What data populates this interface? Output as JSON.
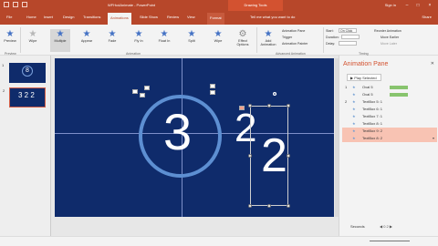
{
  "window": {
    "title": "WFHcdAnimate - PowerPoint",
    "context": "Drawing Tools",
    "signin": "Sign in"
  },
  "tabs": [
    "File",
    "Home",
    "Insert",
    "Design",
    "Transitions",
    "Animations",
    "Slide Show",
    "Review",
    "View",
    "Format"
  ],
  "tellme": "Tell me what you want to do",
  "share": "Share",
  "ribbon": {
    "preview": "Preview",
    "effects": [
      "Wipe",
      "Multiple",
      "Appear",
      "Fade",
      "Fly In",
      "Float In",
      "Split",
      "Wipe"
    ],
    "effect_options": "Effect Options",
    "add_animation": "Add Animation",
    "animation_pane": "Animation Pane",
    "trigger": "Trigger",
    "painter": "Animation Painter",
    "start_label": "Start:",
    "start_value": "On Click",
    "duration_label": "Duration:",
    "delay_label": "Delay:",
    "reorder": "Reorder Animation",
    "move_earlier": "Move Earlier",
    "move_later": "Move Later",
    "groups": [
      "Preview",
      "Animation",
      "Advanced Animation",
      "Timing"
    ]
  },
  "slides": [
    {
      "number": "1",
      "content": "8"
    },
    {
      "number": "2",
      "content": "3 2 2"
    }
  ],
  "canvas": {
    "digit_large": "3",
    "digit_medium": "2",
    "digit_small": "2"
  },
  "pane": {
    "title": "Animation Pane",
    "play": "Play Selected",
    "rows": [
      {
        "num": "1",
        "label": "Oval 5",
        "selected": false,
        "bar": true
      },
      {
        "num": "",
        "label": "Oval 5",
        "selected": false,
        "bar": true
      },
      {
        "num": "2",
        "label": "TextBox 5: 1",
        "selected": false,
        "bar": false
      },
      {
        "num": "",
        "label": "TextBox 6: 1",
        "selected": false,
        "bar": false
      },
      {
        "num": "",
        "label": "TextBox 7: 1",
        "selected": false,
        "bar": false
      },
      {
        "num": "",
        "label": "TextBox 8: 1",
        "selected": false,
        "bar": false
      },
      {
        "num": "",
        "label": "TextBox 9: 2",
        "selected": true,
        "bar": false
      },
      {
        "num": "",
        "label": "TextBox 8: 2",
        "selected": true,
        "bar": false
      }
    ],
    "seconds": "Seconds"
  },
  "colors": {
    "powerpoint": "#b7472a",
    "slide": "#0f2b6b",
    "accent": "#d35230",
    "selection": "#f8c3b3",
    "circle": "#5d8fd2"
  }
}
